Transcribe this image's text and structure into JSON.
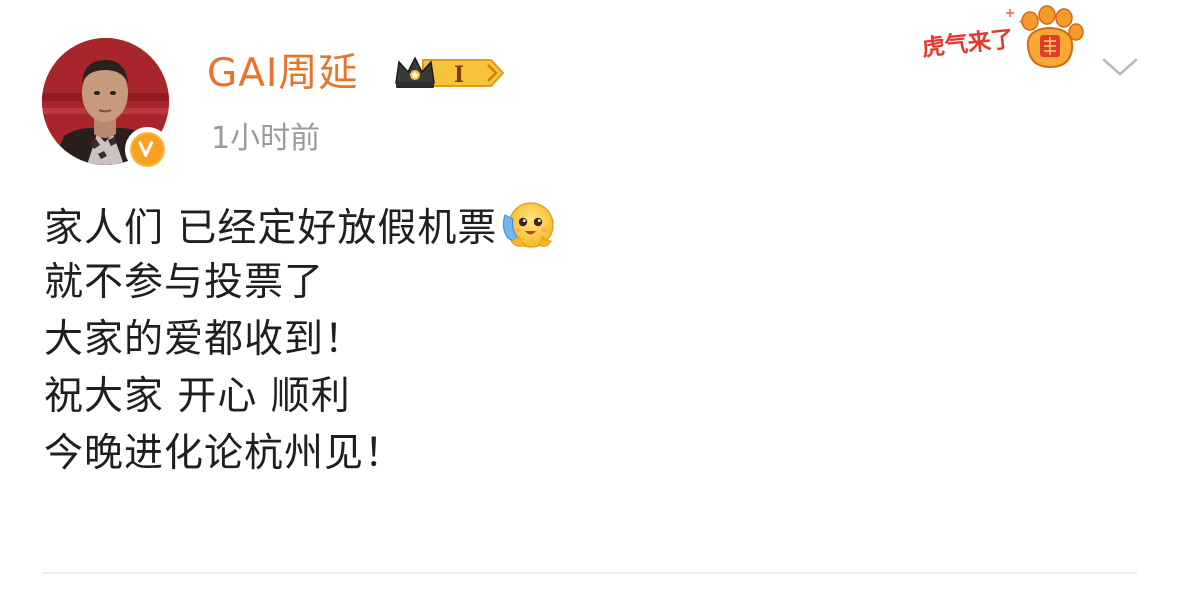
{
  "post": {
    "author_name": "GAI周延",
    "timestamp": "1小时前",
    "member_badge_text": "I",
    "sticker_text": "虎气来了",
    "lines": [
      "家人们 已经定好放假机票",
      "就不参与投票了",
      "大家的爱都收到！",
      "祝大家 开心 顺利",
      "今晚进化论杭州见！"
    ],
    "emoji": "hug-emoji"
  },
  "colors": {
    "author_name": "#e8742b",
    "timestamp": "#9a9a9a",
    "verified_badge": "#f7a11f",
    "sticker_red": "#e23a2e"
  },
  "icons": {
    "verified": "verified-v-icon",
    "crown": "crown-member-icon",
    "dropdown": "chevron-down-icon",
    "sticker": "tiger-paw-sticker"
  }
}
